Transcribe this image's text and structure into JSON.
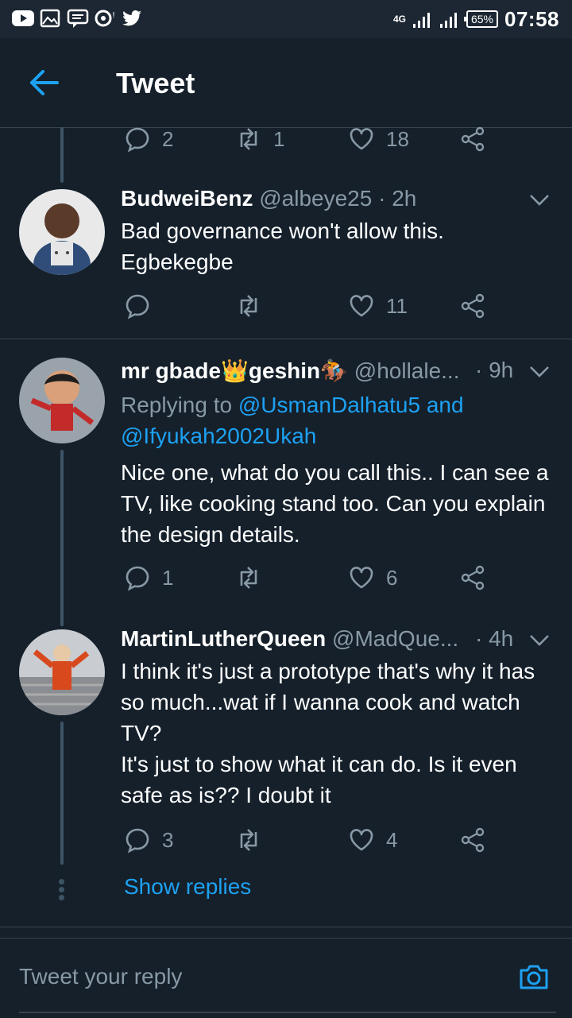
{
  "status_bar": {
    "network": "4G",
    "battery": "65%",
    "time": "07:58"
  },
  "app_bar": {
    "title": "Tweet"
  },
  "top_actions": {
    "replies": "2",
    "retweets": "1",
    "likes": "18"
  },
  "tweets": [
    {
      "name": "BudweiBenz",
      "handle": "@albeye25",
      "time": "· 2h",
      "text_lines": [
        "Bad governance won't allow this.",
        "Egbekegbe"
      ],
      "replies": "",
      "retweets": "",
      "likes": "11"
    },
    {
      "name": "mr gbade👑geshin🏇",
      "handle": "@hollale...",
      "time": "· 9h",
      "replying_prefix": "Replying to",
      "replying_user1": "@UsmanDalhatu5",
      "replying_and": "and",
      "replying_user2": "@Ifyukah2002Ukah",
      "text": "Nice one, what do you call this.. I can see a TV, like cooking stand too. Can you explain the design details.",
      "replies": "1",
      "retweets": "",
      "likes": "6"
    },
    {
      "name": "MartinLutherQueen",
      "handle": "@MadQue...",
      "time": "· 4h",
      "text_line1": "I think it's just a prototype that's why it has so much...wat if I wanna cook and watch TV?",
      "text_line2": "It's just to show what it can do. Is it even safe as is?? I doubt it",
      "replies": "3",
      "retweets": "",
      "likes": "4"
    }
  ],
  "show_replies": "Show replies",
  "reply_placeholder": "Tweet your reply",
  "colors": {
    "background": "#15202b",
    "accent": "#1da1f2",
    "secondary_text": "#8899a6",
    "divider": "#38444d"
  }
}
